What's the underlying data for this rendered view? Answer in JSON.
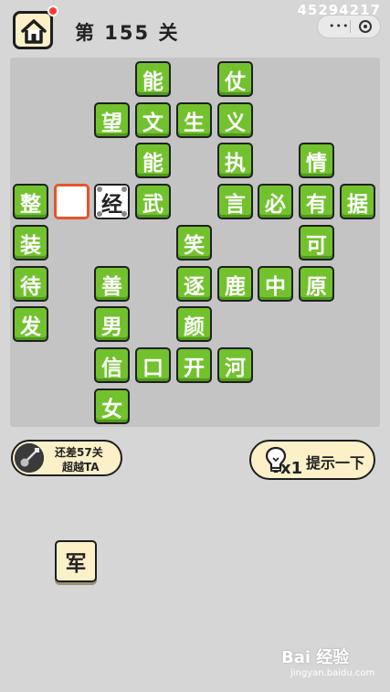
{
  "header": {
    "level_label": "第 155 关",
    "user_id": "45294217",
    "capsule_menu_icon": "ellipsis-icon",
    "capsule_close_icon": "target-icon"
  },
  "grid": {
    "cells": [
      {
        "r": 0,
        "c": 3,
        "ch": "能",
        "state": "green"
      },
      {
        "r": 0,
        "c": 5,
        "ch": "仗",
        "state": "green"
      },
      {
        "r": 1,
        "c": 2,
        "ch": "望",
        "state": "green"
      },
      {
        "r": 1,
        "c": 3,
        "ch": "文",
        "state": "green"
      },
      {
        "r": 1,
        "c": 4,
        "ch": "生",
        "state": "green"
      },
      {
        "r": 1,
        "c": 5,
        "ch": "义",
        "state": "green"
      },
      {
        "r": 2,
        "c": 3,
        "ch": "能",
        "state": "green"
      },
      {
        "r": 2,
        "c": 5,
        "ch": "执",
        "state": "green"
      },
      {
        "r": 2,
        "c": 7,
        "ch": "情",
        "state": "green"
      },
      {
        "r": 3,
        "c": 0,
        "ch": "整",
        "state": "green"
      },
      {
        "r": 3,
        "c": 1,
        "ch": "",
        "state": "blank"
      },
      {
        "r": 3,
        "c": 2,
        "ch": "经",
        "state": "white"
      },
      {
        "r": 3,
        "c": 3,
        "ch": "武",
        "state": "green"
      },
      {
        "r": 3,
        "c": 5,
        "ch": "言",
        "state": "green"
      },
      {
        "r": 3,
        "c": 6,
        "ch": "必",
        "state": "green"
      },
      {
        "r": 3,
        "c": 7,
        "ch": "有",
        "state": "green"
      },
      {
        "r": 3,
        "c": 8,
        "ch": "据",
        "state": "green"
      },
      {
        "r": 4,
        "c": 0,
        "ch": "装",
        "state": "green"
      },
      {
        "r": 4,
        "c": 4,
        "ch": "笑",
        "state": "green"
      },
      {
        "r": 4,
        "c": 7,
        "ch": "可",
        "state": "green"
      },
      {
        "r": 5,
        "c": 0,
        "ch": "待",
        "state": "green"
      },
      {
        "r": 5,
        "c": 2,
        "ch": "善",
        "state": "green"
      },
      {
        "r": 5,
        "c": 4,
        "ch": "逐",
        "state": "green"
      },
      {
        "r": 5,
        "c": 5,
        "ch": "鹿",
        "state": "green"
      },
      {
        "r": 5,
        "c": 6,
        "ch": "中",
        "state": "green"
      },
      {
        "r": 5,
        "c": 7,
        "ch": "原",
        "state": "green"
      },
      {
        "r": 6,
        "c": 0,
        "ch": "发",
        "state": "green"
      },
      {
        "r": 6,
        "c": 2,
        "ch": "男",
        "state": "green"
      },
      {
        "r": 6,
        "c": 4,
        "ch": "颜",
        "state": "green"
      },
      {
        "r": 7,
        "c": 2,
        "ch": "信",
        "state": "green"
      },
      {
        "r": 7,
        "c": 3,
        "ch": "口",
        "state": "green"
      },
      {
        "r": 7,
        "c": 4,
        "ch": "开",
        "state": "green"
      },
      {
        "r": 7,
        "c": 5,
        "ch": "河",
        "state": "green"
      },
      {
        "r": 8,
        "c": 2,
        "ch": "女",
        "state": "green"
      }
    ]
  },
  "rank_badge": {
    "line1": "还差57关",
    "line2": "超越TA"
  },
  "hint_button": {
    "count": "x1",
    "label": "提示一下"
  },
  "options": [
    "军"
  ],
  "watermark": {
    "brand": "Bai 经验",
    "url": "jingyan.baidu.com"
  },
  "colors": {
    "tile_green": "#72c22e",
    "panel_cream": "#fbf0c8",
    "blank_outline": "#e5552a"
  }
}
